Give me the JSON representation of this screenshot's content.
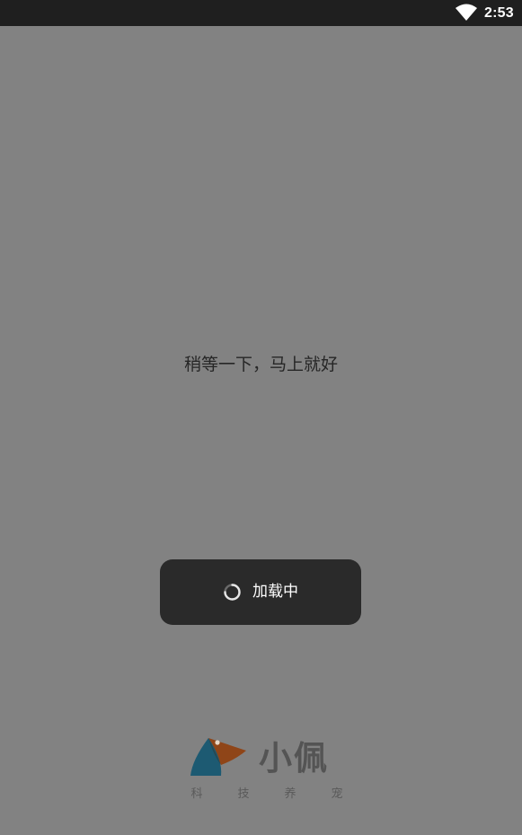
{
  "status_bar": {
    "time": "2:53",
    "wifi_icon": "wifi-icon"
  },
  "screen": {
    "wait_message": "稍等一下，马上就好"
  },
  "loading_toast": {
    "label": "加载中",
    "spinner_icon": "spinner-icon"
  },
  "brand": {
    "logo_icon": "bird-logo-icon",
    "name": "小佩",
    "slogan": [
      "科",
      "技",
      "养",
      "宠"
    ],
    "colors": {
      "teal": "#1e5f78",
      "orange": "#9a4a1a",
      "text": "#545454"
    }
  },
  "colors": {
    "status_bar_bg": "#1f1f1f",
    "screen_overlay": "#828282",
    "toast_bg": "#2a2a2a"
  }
}
